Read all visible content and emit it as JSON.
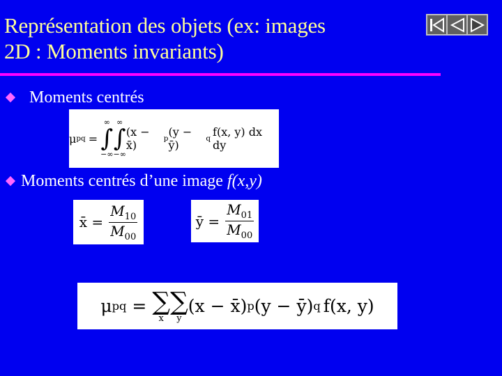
{
  "slide": {
    "title_line1": "Représentation des objets (ex: images",
    "title_line2": "2D : Moments invariants)"
  },
  "nav": {
    "buttons": [
      {
        "name": "first-slide-icon"
      },
      {
        "name": "previous-slide-icon"
      },
      {
        "name": "next-slide-icon"
      }
    ]
  },
  "bullets": [
    {
      "text": "Moments centrés"
    },
    {
      "text": "Moments centrés d’une image",
      "italic": "f(x,y)"
    }
  ],
  "equations": {
    "continuous": {
      "lhs": "μ",
      "lhs_sub": "pq",
      "eq": "=",
      "int_upper": "∞",
      "int_lower": "−∞",
      "int_symbol": "∫",
      "body1": "(x − x̄)",
      "p": "p",
      "body2": "(y − ȳ)",
      "q": "q",
      "body3": "f(x, y) dx dy"
    },
    "xbar": {
      "lhs": "x̄ =",
      "num": "M",
      "num_sub": "10",
      "den": "M",
      "den_sub": "00"
    },
    "ybar": {
      "lhs": "ȳ =",
      "num": "M",
      "num_sub": "01",
      "den": "M",
      "den_sub": "00"
    },
    "discrete": {
      "lhs": "μ",
      "lhs_sub": "pq",
      "eq": "=",
      "sum_symbol": "∑",
      "sum_x": "x",
      "sum_y": "y",
      "body1": "(x − x̄)",
      "p": "p",
      "body2": "(y − ȳ)",
      "q": "q",
      "body3": "f(x, y)"
    }
  },
  "colors": {
    "background": "#0000f0",
    "title": "#ffff99",
    "rule": "#ff00ff",
    "bullet": "#ff66ff",
    "text": "#ffffff"
  }
}
